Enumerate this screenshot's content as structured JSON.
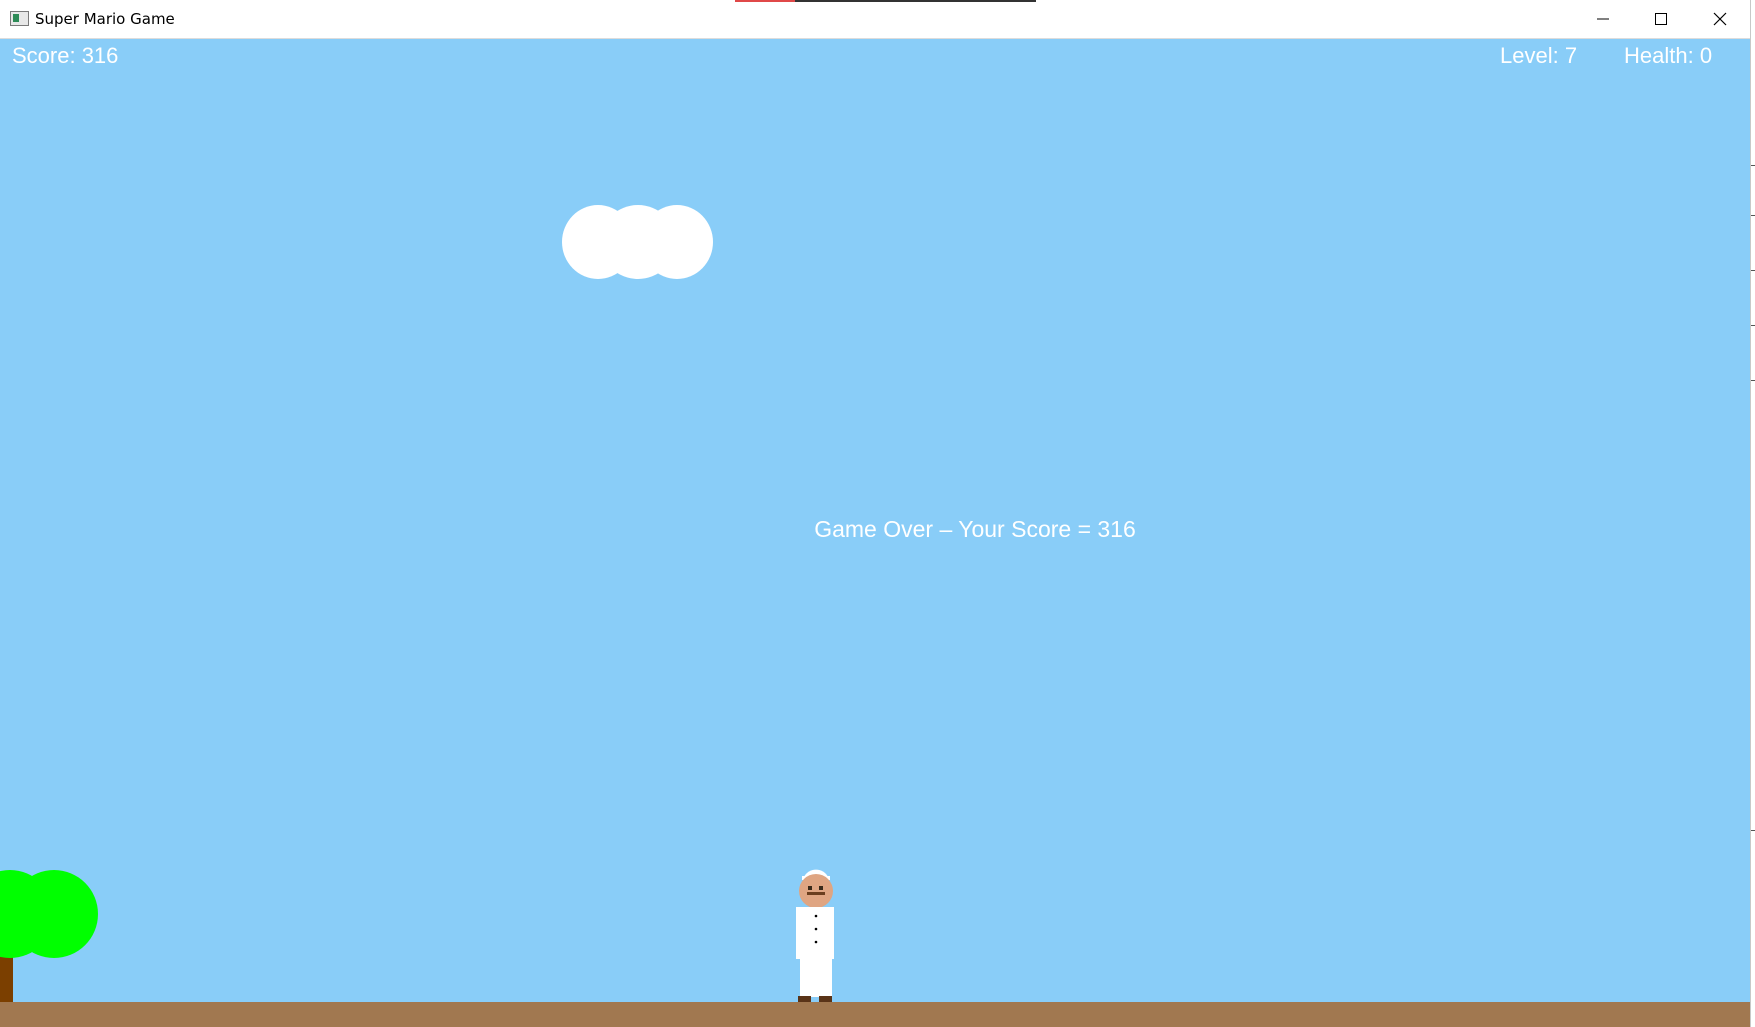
{
  "window": {
    "title": "Super Mario Game",
    "controls": [
      "minimize",
      "maximize",
      "close"
    ]
  },
  "hud": {
    "score_label": "Score: 316",
    "level_label": "Level: 7",
    "health_label": "Health: 0"
  },
  "game_state": {
    "score": 316,
    "level": 7,
    "health": 0,
    "message": "Game Over – Your Score = 316"
  },
  "colors": {
    "sky": "#89cdf8",
    "ground": "#a17850",
    "cloud": "#ffffff",
    "tree_foliage": "#00ff00",
    "tree_trunk": "#7b3f00",
    "hud_text": "#ffffff"
  },
  "icons": {
    "app": "app-window-icon",
    "minimize": "minimize-icon",
    "maximize": "maximize-icon",
    "close": "close-icon"
  }
}
